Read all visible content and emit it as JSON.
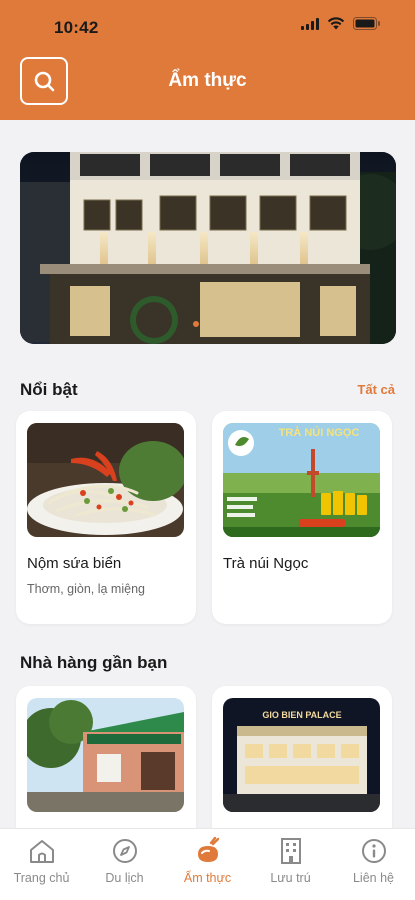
{
  "status_bar": {
    "time": "10:42"
  },
  "header": {
    "title": "Ẩm thực"
  },
  "featured": {
    "title": "Nổi bật",
    "see_all": "Tất cả",
    "items": [
      {
        "title": "Nộm sứa biển",
        "subtitle": "Thơm, giòn, lạ miệng"
      },
      {
        "title": "Trà núi Ngọc",
        "subtitle": "",
        "banner": "TRÀ NÚI NGỌC"
      }
    ]
  },
  "nearby": {
    "title": "Nhà hàng gần bạn",
    "items": [
      {
        "title": "",
        "sign": ""
      },
      {
        "title": "",
        "sign": "GIO BIEN PALACE"
      }
    ]
  },
  "tabbar": {
    "items": [
      {
        "label": "Trang chủ",
        "icon": "home-icon",
        "active": false
      },
      {
        "label": "Du lịch",
        "icon": "compass-icon",
        "active": false
      },
      {
        "label": "Ẩm thực",
        "icon": "food-icon",
        "active": true
      },
      {
        "label": "Lưu trú",
        "icon": "building-icon",
        "active": false
      },
      {
        "label": "Liên hệ",
        "icon": "info-icon",
        "active": false
      }
    ]
  },
  "colors": {
    "accent": "#E07A3B",
    "background": "#F2F2F4",
    "text": "#1A1A1A"
  }
}
